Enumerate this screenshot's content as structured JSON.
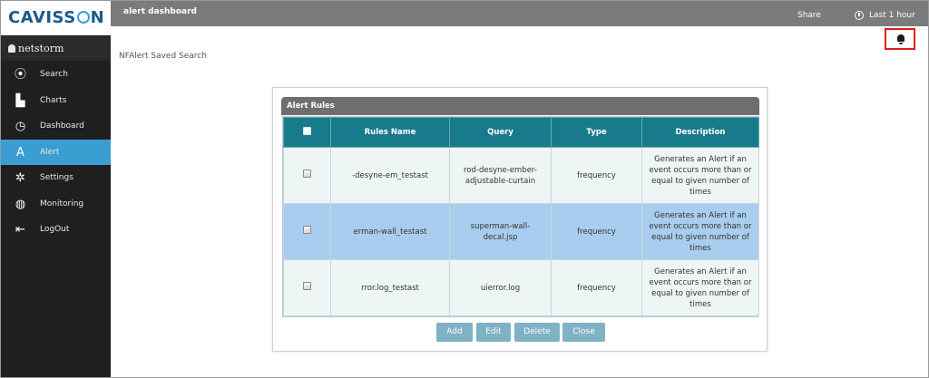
{
  "app": {
    "logo": "CAVISS",
    "logo_end": "N",
    "user": "netstorm"
  },
  "sidebar": {
    "items": [
      {
        "label": "Search",
        "icon": "compass-icon",
        "glyph": "⦿",
        "active": false
      },
      {
        "label": "Charts",
        "icon": "bar-chart-icon",
        "glyph": "▙",
        "active": false
      },
      {
        "label": "Dashboard",
        "icon": "dashboard-icon",
        "glyph": "◷",
        "active": false
      },
      {
        "label": "Alert",
        "icon": "alert-icon",
        "glyph": "A",
        "active": true
      },
      {
        "label": "Settings",
        "icon": "gear-icon",
        "glyph": "✲",
        "active": false
      },
      {
        "label": "Monitoring",
        "icon": "globe-icon",
        "glyph": "◍",
        "active": false
      },
      {
        "label": "LogOut",
        "icon": "logout-icon",
        "glyph": "⇤",
        "active": false
      }
    ]
  },
  "topbar": {
    "title": "alert dashboard",
    "share": "Share",
    "time_range": "Last 1 hour"
  },
  "page": {
    "saved_search_label": "NFAlert Saved Search"
  },
  "dialog": {
    "title": "Alert Rules",
    "columns": [
      "Rules Name",
      "Query",
      "Type",
      "Description"
    ],
    "rows": [
      {
        "name": "-desyne-em_testast",
        "query": "rod-desyne-ember-adjustable-curtain",
        "type": "frequency",
        "description": "Generates an Alert if an event occurs more than or equal to given number of times",
        "selected": false
      },
      {
        "name": "erman-wall_testast",
        "query": "superman-wall-decal.jsp",
        "type": "frequency",
        "description": "Generates an Alert if an event occurs more than or equal to given number of times",
        "selected": true
      },
      {
        "name": "rror.log_testast",
        "query": "uierror.log",
        "type": "frequency",
        "description": "Generates an Alert if an event occurs more than or equal to given number of times",
        "selected": false
      }
    ],
    "buttons": {
      "add": "Add",
      "edit": "Edit",
      "delete": "Delete",
      "close": "Close"
    }
  },
  "colors": {
    "accent": "#3a9ed3",
    "header": "#187b8c",
    "selected_row": "#a9cdee",
    "button": "#7fb2c4",
    "highlight_border": "#e02020"
  }
}
